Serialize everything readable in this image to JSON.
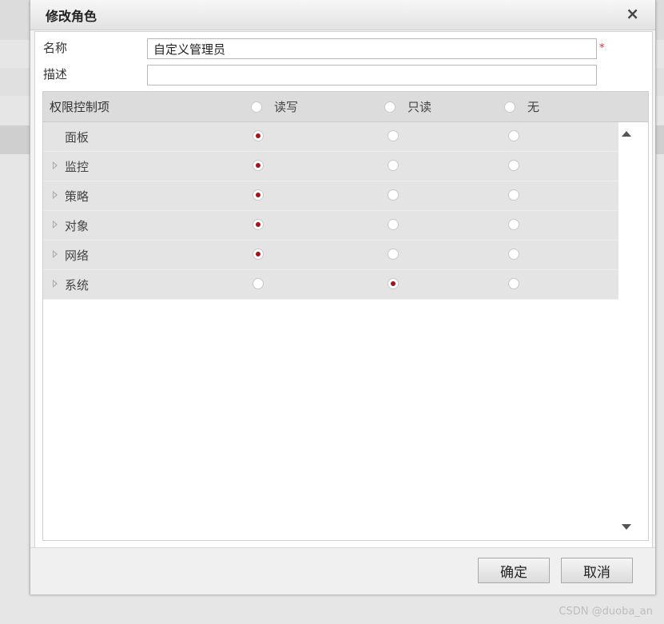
{
  "dialog": {
    "title": "修改角色",
    "close_label": "×",
    "name_label": "名称",
    "name_value": "自定义管理员",
    "required_mark": "*",
    "desc_label": "描述",
    "desc_value": ""
  },
  "permissions": {
    "header": {
      "label": "权限控制项",
      "options": [
        "读写",
        "只读",
        "无"
      ]
    },
    "rows": [
      {
        "label": "面板",
        "expandable": false,
        "selected": 0
      },
      {
        "label": "监控",
        "expandable": true,
        "selected": 0
      },
      {
        "label": "策略",
        "expandable": true,
        "selected": 0
      },
      {
        "label": "对象",
        "expandable": true,
        "selected": 0
      },
      {
        "label": "网络",
        "expandable": true,
        "selected": 0
      },
      {
        "label": "系统",
        "expandable": true,
        "selected": 1
      }
    ]
  },
  "footer": {
    "ok_label": "确定",
    "cancel_label": "取消"
  },
  "watermark": "CSDN @duoba_an",
  "colors": {
    "radio_selected": "#a3141b",
    "row_background": "#e4e4e4",
    "header_background": "#dcdcdc"
  }
}
